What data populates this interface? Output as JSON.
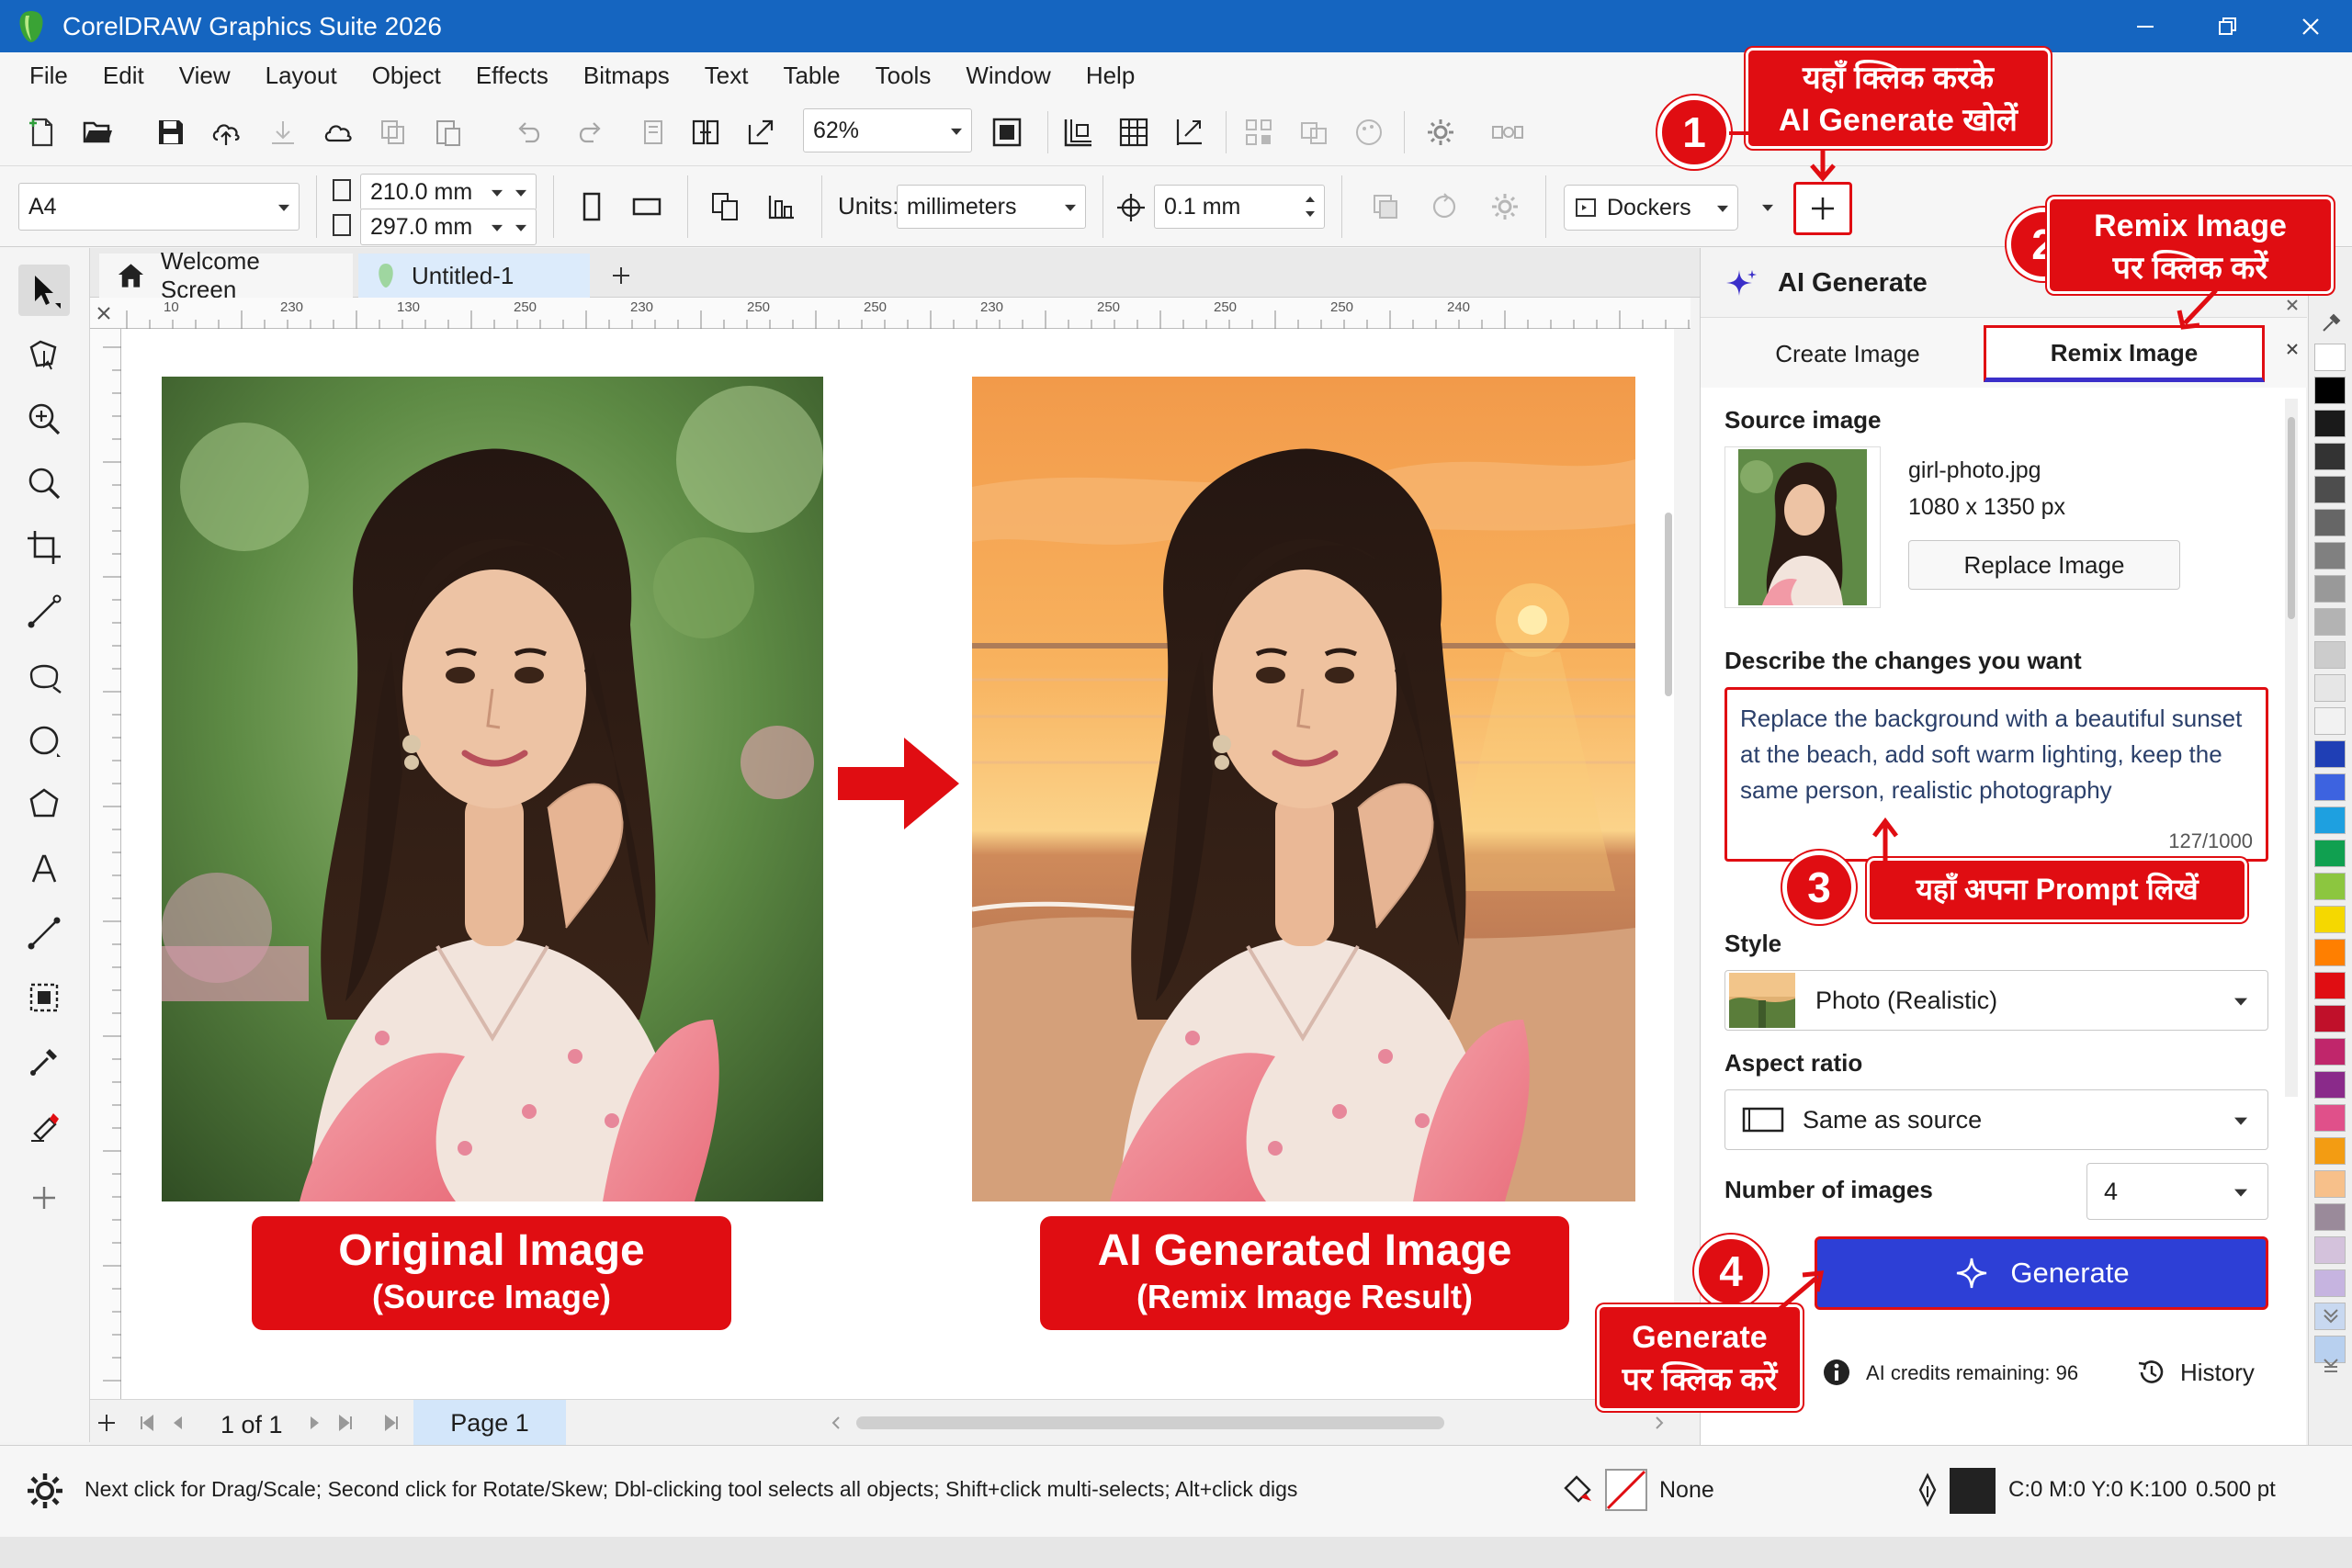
{
  "window": {
    "title": "CorelDRAW Graphics Suite 2026"
  },
  "menu": [
    "File",
    "Edit",
    "View",
    "Layout",
    "Object",
    "Effects",
    "Bitmaps",
    "Text",
    "Table",
    "Tools",
    "Window",
    "Help"
  ],
  "toolbar": {
    "zoom": "62%"
  },
  "property_bar": {
    "page_size": "A4",
    "width": "210.0 mm",
    "height": "297.0 mm",
    "units_label": "Units:",
    "units": "millimeters",
    "nudge": "0.1 mm",
    "dockers": "Dockers"
  },
  "doc_tabs": [
    "Welcome Screen",
    "Untitled-1"
  ],
  "ruler_labels": [
    "10",
    "230",
    "130",
    "250",
    "230",
    "250",
    "250",
    "230",
    "250",
    "250",
    "250",
    "240"
  ],
  "canvas": {
    "original_title": "Original Image",
    "original_subtitle": "(Source Image)",
    "generated_title": "AI Generated Image",
    "generated_subtitle": "(Remix Image Result)"
  },
  "pagebar": {
    "page_info": "1 of 1",
    "page_tab": "Page 1"
  },
  "status": {
    "hint": "Next click for Drag/Scale; Second click for Rotate/Skew; Dbl-clicking tool selects all objects; Shift+click multi-selects; Alt+click digs",
    "fill": "None",
    "outline_color": "C:0 M:0 Y:0 K:100",
    "outline_width": "0.500 pt"
  },
  "panel": {
    "title": "AI Generate",
    "tabs": [
      "Create Image",
      "Remix Image"
    ],
    "source_label": "Source image",
    "file_name": "girl-photo.jpg",
    "file_dims": "1080 x 1350 px",
    "replace_button": "Replace Image",
    "describe_label": "Describe the changes you want",
    "prompt": "Replace the background with a beautiful sunset at the beach, add soft warm lighting, keep the same person, realistic photography",
    "char_count": "127/1000",
    "style_label": "Style",
    "style_value": "Photo (Realistic)",
    "aspect_label": "Aspect ratio",
    "aspect_value": "Same as source",
    "count_label": "Number of images",
    "count_value": "4",
    "generate_button": "Generate",
    "credits": "AI credits remaining: 96",
    "history": "History"
  },
  "annotations": {
    "step1": "1",
    "step1_text": [
      "यहाँ क्लिक करके",
      "AI Generate खोलें"
    ],
    "step2": "2",
    "step2_text": [
      "Remix Image",
      "पर क्लिक करें"
    ],
    "step3": "3",
    "step3_text": "यहाँ अपना Prompt लिखें",
    "step4": "4",
    "step4_text": [
      "Generate",
      "पर क्लिक करें"
    ]
  },
  "colors": {
    "titlebar": "#1565c0",
    "annotation_red": "#e00d12",
    "generate_button": "#2d3fd6",
    "active_tab_underline": "#3b2fc9"
  }
}
